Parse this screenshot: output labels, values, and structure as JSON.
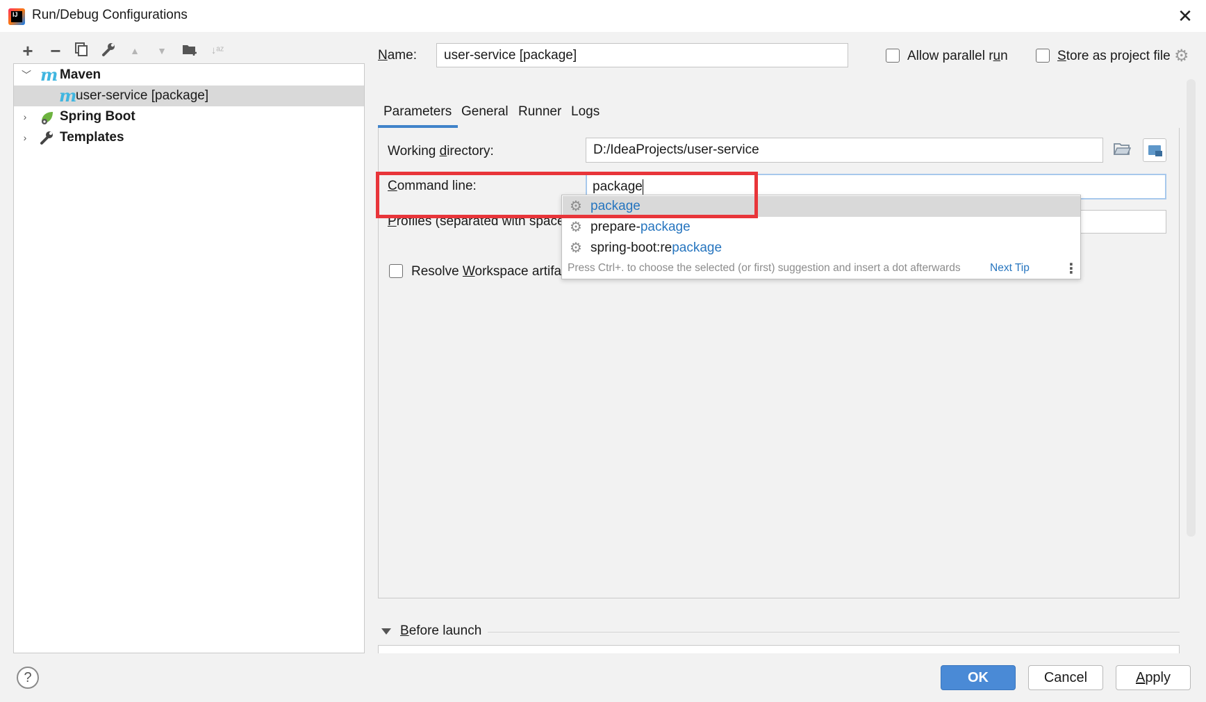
{
  "window": {
    "title": "Run/Debug Configurations",
    "app_icon_text": "IJ",
    "close_glyph": "✕"
  },
  "toolbar": {
    "add": "+",
    "remove": "−",
    "copy": "⧉",
    "edit": "🔧",
    "move_up": "▲",
    "move_down": "▼",
    "folder": "📁",
    "sort": "↓ᵃᶻ"
  },
  "tree": {
    "items": [
      {
        "label": "Maven",
        "icon": "maven-icon",
        "expanded": true
      },
      {
        "label": "user-service [package]",
        "icon": "maven-icon",
        "selected": true
      },
      {
        "label": "Spring Boot",
        "icon": "spring-boot-icon",
        "expanded": false
      },
      {
        "label": "Templates",
        "icon": "wrench-icon",
        "expanded": false
      }
    ],
    "maven_glyph": "m"
  },
  "form": {
    "name_label_u": "N",
    "name_label_rest": "ame:",
    "name_value": "user-service [package]",
    "allow_parallel_pre": "Allow parallel r",
    "allow_parallel_u": "u",
    "allow_parallel_post": "n",
    "store_u": "S",
    "store_rest": "tore as project file"
  },
  "tabs": [
    {
      "label": "Parameters",
      "active": true
    },
    {
      "label": "General"
    },
    {
      "label": "Runner"
    },
    {
      "label": "Logs"
    }
  ],
  "parameters": {
    "workdir_pre": "Working ",
    "workdir_u": "d",
    "workdir_post": "irectory:",
    "workdir_value": "D:/IdeaProjects/user-service",
    "cmd_u": "C",
    "cmd_rest": "ommand line:",
    "cmd_value": "package",
    "profiles_u": "P",
    "profiles_rest": "rofiles (separated with space",
    "resolve_pre": "Resolve ",
    "resolve_u": "W",
    "resolve_post": "orkspace artifa"
  },
  "autocomplete": {
    "items": [
      {
        "prefix": "",
        "match": "package"
      },
      {
        "prefix": "prepare-",
        "match": "package"
      },
      {
        "prefix": "spring-boot:re",
        "match": "package"
      }
    ],
    "hint": "Press Ctrl+. to choose the selected (or first) suggestion and insert a dot afterwards",
    "next_tip": "Next Tip",
    "more": "⋮"
  },
  "before_launch": {
    "label_u": "B",
    "label_rest": "efore launch"
  },
  "footer": {
    "ok": "OK",
    "cancel": "Cancel",
    "apply_u": "A",
    "apply_rest": "pply",
    "help": "?"
  },
  "colors": {
    "accent": "#4083c9",
    "ok_button": "#4a8ad6",
    "highlight_box": "#e8353a",
    "match_text": "#2675bf",
    "maven_icon": "#40b6e0",
    "spring_icon": "#6db33f"
  }
}
